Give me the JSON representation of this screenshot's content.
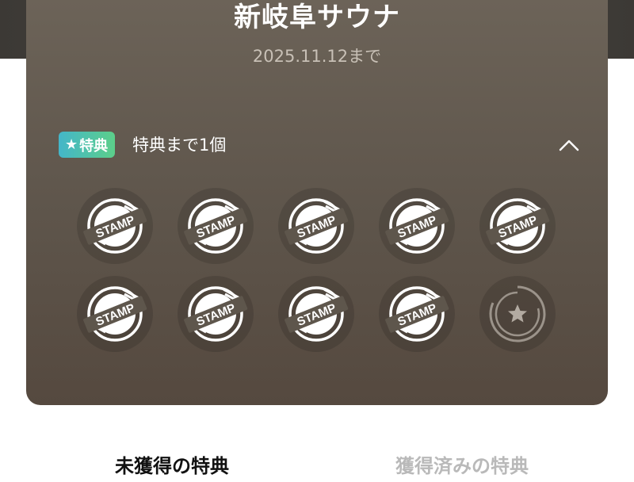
{
  "store": {
    "name": "新岐阜サウナ",
    "deadline": "2025.11.12まで"
  },
  "benefit": {
    "badge_icon": "star-icon",
    "badge_label": "特典",
    "progress_text": "特典まで1個",
    "toggle_icon": "chevron-up-icon",
    "badge_colors": [
      "#44b6c9",
      "#5ccf8a"
    ]
  },
  "stamp_card": {
    "total": 10,
    "collected": 9,
    "stamp_text": "STAMP",
    "slots": [
      {
        "state": "stamped",
        "text": "STAMP"
      },
      {
        "state": "stamped",
        "text": "STAMP"
      },
      {
        "state": "stamped",
        "text": "STAMP"
      },
      {
        "state": "stamped",
        "text": "STAMP"
      },
      {
        "state": "stamped",
        "text": "STAMP"
      },
      {
        "state": "stamped",
        "text": "STAMP"
      },
      {
        "state": "stamped",
        "text": "STAMP"
      },
      {
        "state": "stamped",
        "text": "STAMP"
      },
      {
        "state": "stamped",
        "text": "STAMP"
      },
      {
        "state": "empty-goal",
        "icon": "star-icon"
      }
    ]
  },
  "tabs": [
    {
      "label": "未獲得の特典",
      "active": true
    },
    {
      "label": "獲得済みの特典",
      "active": false
    }
  ]
}
